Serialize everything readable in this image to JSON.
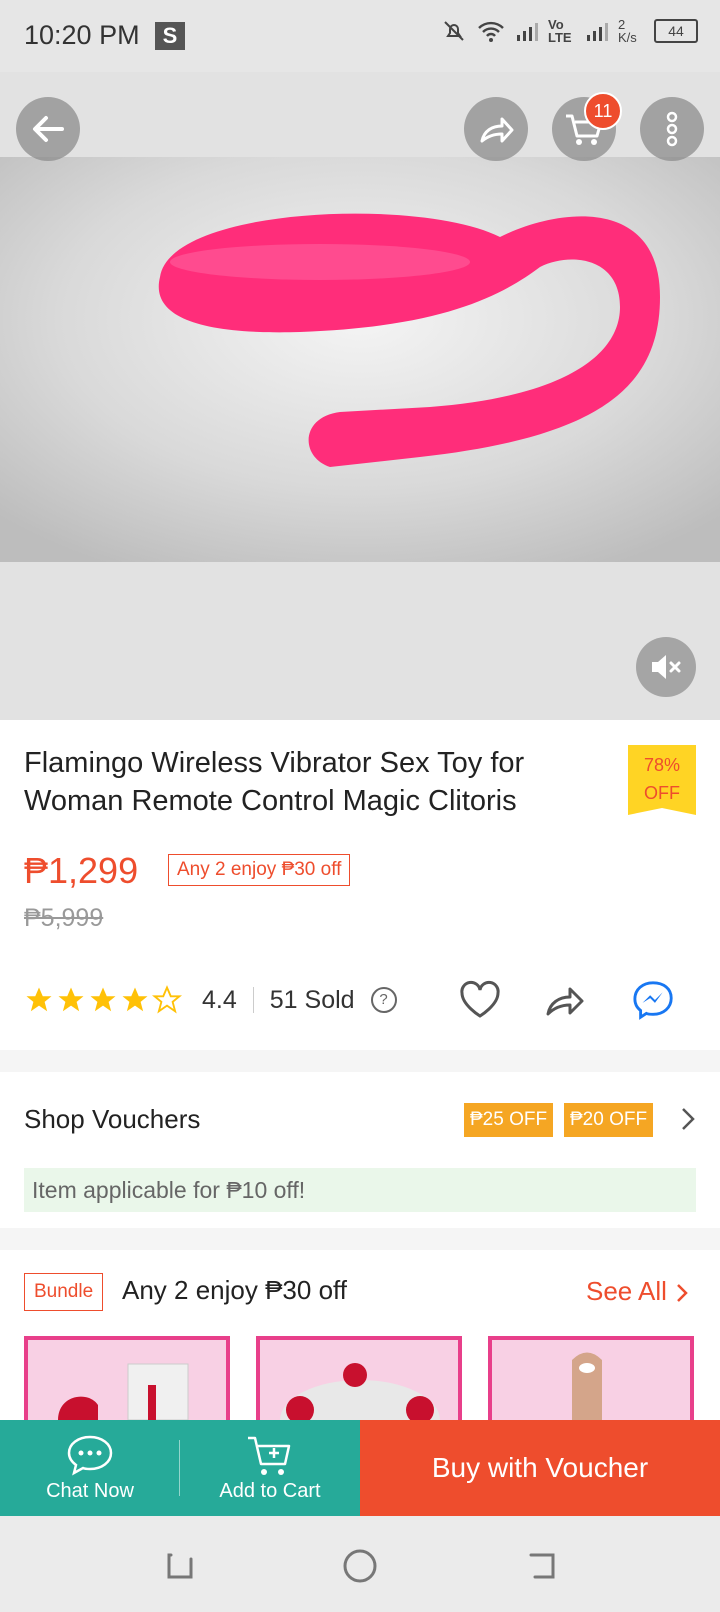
{
  "status_bar": {
    "time": "10:20 PM",
    "s_badge": "S",
    "volte": "Vo LTE",
    "speed": "2 K/s",
    "battery": "44"
  },
  "product": {
    "cart_count": "11",
    "title": "Flamingo Wireless Vibrator Sex Toy for Woman Remote Control Magic Clitoris",
    "discount": "78%\nOFF",
    "discount_pct": "78%",
    "discount_off": "OFF",
    "price": "₱1,299",
    "promo": "Any 2 enjoy ₱30 off",
    "original_price": "₱5,999",
    "rating": "4.4",
    "rating_value": 4.4,
    "sold": "51 Sold",
    "help": "?"
  },
  "vouchers": {
    "label": "Shop Vouchers",
    "chips": [
      "₱25 OFF",
      "₱20 OFF"
    ],
    "applicable": "Item applicable for ₱10 off!"
  },
  "bundle": {
    "tag": "Bundle",
    "title": "Any 2 enjoy ₱30 off",
    "see_all": "See All"
  },
  "bottom_bar": {
    "chat": "Chat Now",
    "add_cart": "Add to Cart",
    "buy": "Buy with Voucher"
  },
  "colors": {
    "accent": "#ee4d2d",
    "teal": "#26aa99",
    "voucher": "#f5a623",
    "badge_yellow": "#ffd424"
  }
}
